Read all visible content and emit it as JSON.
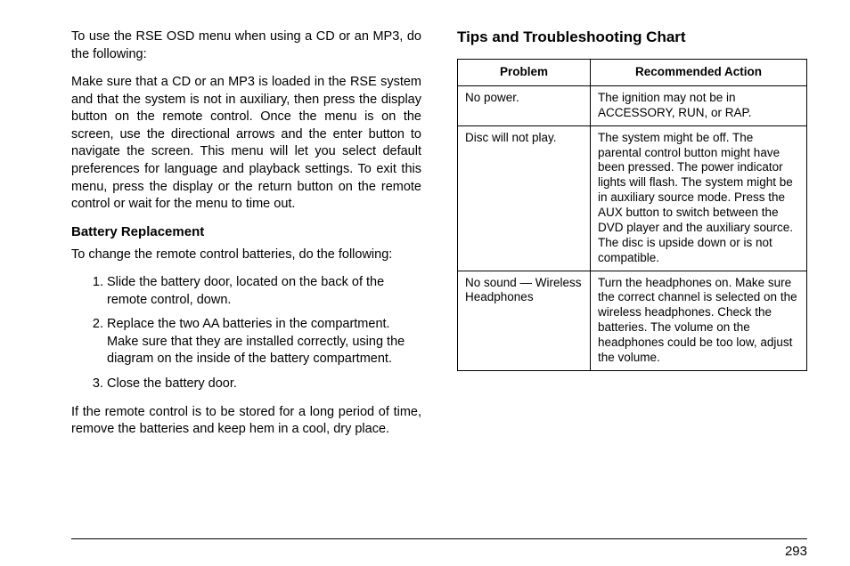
{
  "left": {
    "intro": "To use the RSE OSD menu when using a CD or an MP3, do the following:",
    "para": "Make sure that a CD or an MP3 is loaded in the RSE system and that the system is not in auxiliary, then press the display button on the remote control. Once the menu is on the screen, use the directional arrows and the enter button to navigate the screen. This menu will let you select default preferences for language and playback settings. To exit this menu, press the display or the return button on the remote control or wait for the menu to time out.",
    "battery_heading": "Battery Replacement",
    "battery_intro": "To change the remote control batteries, do the following:",
    "steps": [
      "Slide the battery door, located on the back of the remote control, down.",
      "Replace the two AA batteries in the compartment. Make sure that they are installed correctly, using the diagram on the inside of the battery compartment.",
      "Close the battery door."
    ],
    "battery_note": "If the remote control is to be stored for a long period of time, remove the batteries and keep hem in a cool, dry place."
  },
  "right": {
    "heading": "Tips and Troubleshooting Chart"
  },
  "chart_data": {
    "type": "table",
    "headers": [
      "Problem",
      "Recommended Action"
    ],
    "rows": [
      {
        "problem": "No power.",
        "action": "The ignition may not be in ACCESSORY, RUN, or RAP."
      },
      {
        "problem": "Disc will not play.",
        "action": "The system might be off. The parental control button might have been pressed. The power indicator lights will flash. The system might be in auxiliary source mode. Press the AUX button to switch between the DVD player and the auxiliary source. The disc is upside down or is not compatible."
      },
      {
        "problem": "No sound — Wireless Headphones",
        "action": "Turn the headphones on. Make sure the correct channel is selected on the wireless headphones. Check the batteries. The volume on the headphones could be too low, adjust the volume."
      }
    ]
  },
  "page_number": "293"
}
